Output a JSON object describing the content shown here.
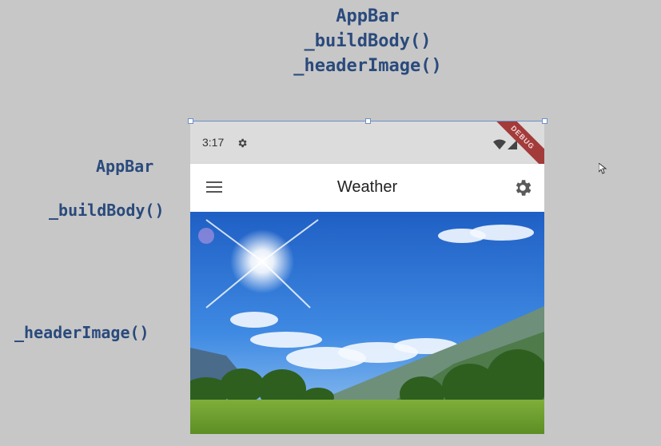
{
  "slide": {
    "top_labels": [
      "AppBar",
      "_buildBody()",
      "_headerImage()"
    ],
    "side_labels": {
      "appbar": "AppBar",
      "build_body": "_buildBody()",
      "header_image": "_headerImage()"
    }
  },
  "phone": {
    "status_bar": {
      "time": "3:17",
      "debug_banner": "DEBUG"
    },
    "app_bar": {
      "title": "Weather",
      "leading_icon": "menu-icon",
      "action_icon": "settings-icon"
    },
    "header_image": {
      "description_icon": "landscape-image"
    }
  },
  "colors": {
    "slide_background": "#c7c7c7",
    "label_color": "#2a4a7c",
    "debug_ribbon": "#a33b3b"
  }
}
